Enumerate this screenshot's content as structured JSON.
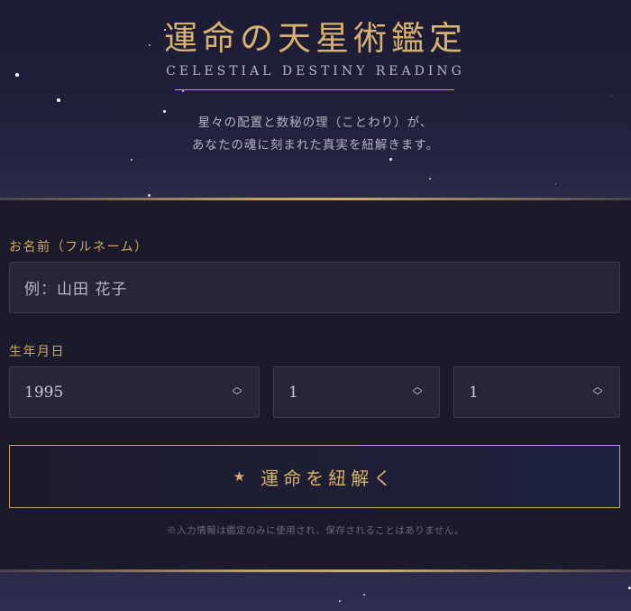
{
  "header": {
    "title": "運命の天星術鑑定",
    "subtitle": "CELESTIAL DESTINY READING",
    "description_line1": "星々の配置と数秘の理（ことわり）が、",
    "description_line2": "あなたの魂に刻まれた真実を紐解きます。"
  },
  "form": {
    "name_label": "お名前（フルネーム）",
    "name_placeholder": "例：山田 花子",
    "birthdate_label": "生年月日",
    "year_value": "1995",
    "month_value": "1",
    "day_value": "1",
    "submit_label": "運命を紐解く",
    "submit_icon": "star-icon",
    "notice": "※入力情報は鑑定のみに使用され、保存されることはありません。"
  },
  "colors": {
    "gold": "#d6b26d",
    "background": "#1b1a2c",
    "field": "#262636"
  }
}
